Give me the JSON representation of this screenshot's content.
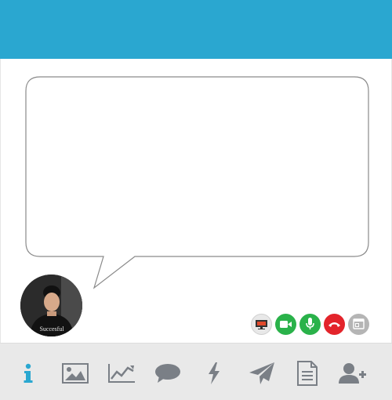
{
  "header": {
    "color": "#2aa7d0"
  },
  "message": {
    "text": ""
  },
  "avatar": {
    "shirt_text": "Succesful"
  },
  "call_controls": [
    {
      "icon": "screen-share-icon",
      "color": "#e8e8e8"
    },
    {
      "icon": "video-camera-icon",
      "color": "#2ab24a"
    },
    {
      "icon": "microphone-icon",
      "color": "#2ab24a"
    },
    {
      "icon": "hang-up-phone-icon",
      "color": "#e3242b"
    },
    {
      "icon": "window-icon",
      "color": "#b5b5b5"
    }
  ],
  "toolbar": {
    "items": [
      {
        "icon": "info-icon",
        "active": true
      },
      {
        "icon": "image-icon",
        "active": false
      },
      {
        "icon": "chart-icon",
        "active": false
      },
      {
        "icon": "chat-bubble-icon",
        "active": false
      },
      {
        "icon": "lightning-icon",
        "active": false
      },
      {
        "icon": "send-icon",
        "active": false
      },
      {
        "icon": "document-icon",
        "active": false
      },
      {
        "icon": "add-user-icon",
        "active": false
      }
    ],
    "active_color": "#2aa7d0",
    "icon_color": "#7a7f86"
  }
}
